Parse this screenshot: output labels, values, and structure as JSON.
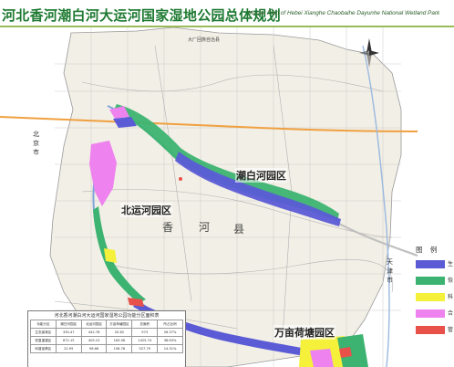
{
  "header": {
    "title_cn": "河北香河潮白河大运河国家湿地公园总体规划",
    "title_en": "Master Plan of Hebei Xianghe Chaobaihe Dayunhe National Wetland Park"
  },
  "map_labels": {
    "chaobaihe_park": "潮白河园区",
    "beiyunhe_park": "北运河园区",
    "wanmu_park": "万亩荷塘园区",
    "county_1": "香",
    "county_2": "河",
    "county_3": "县",
    "beijing_1": "北",
    "beijing_2": "京",
    "beijing_3": "市",
    "tianjin_1": "天",
    "tianjin_2": "津",
    "tianjin_3": "市",
    "road_top": "大厂回族自治县"
  },
  "legend": {
    "title": "图 例",
    "items": [
      {
        "label": "生",
        "color": "#5b5bd6"
      },
      {
        "label": "恢",
        "color": "#3cb371"
      },
      {
        "label": "科",
        "color": "#f5f03a"
      },
      {
        "label": "合",
        "color": "#ee82ee"
      },
      {
        "label": "管",
        "color": "#e8504a"
      }
    ]
  },
  "table": {
    "caption": "河北香河潮白河大运河国家湿地公园功能分区面积表",
    "headers": [
      "功能分区",
      "潮白河园区",
      "北运河园区",
      "万亩荷塘园区",
      "总面积",
      "所占比例"
    ],
    "rows": [
      [
        "生态保育区",
        "330.47",
        "442.78",
        "20.62",
        "973",
        "26.37%"
      ],
      [
        "恢复重建区",
        "672.15",
        "405.10",
        "163.06",
        "1425.74",
        "38.63%"
      ],
      [
        "科普宣教区",
        "22.95",
        "98.68",
        "156.78",
        "527.79",
        "14.31%"
      ]
    ]
  }
}
